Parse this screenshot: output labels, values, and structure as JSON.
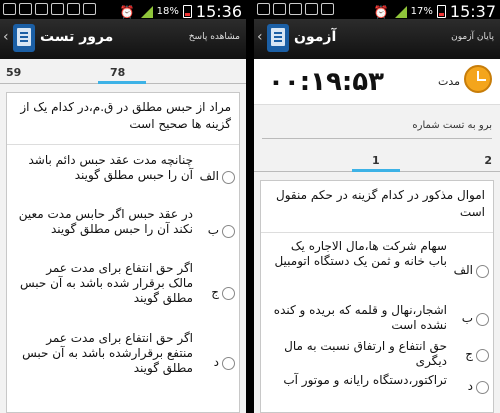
{
  "left": {
    "status": {
      "battery": "18%",
      "time": "15:36"
    },
    "header": {
      "title": "مرور تست",
      "action": "مشاهده پاسخ"
    },
    "tabs": [
      {
        "label": "59"
      },
      {
        "label": "78"
      }
    ],
    "question": "مراد از حبس مطلق در ق.م،در کدام یک از گزینه ها صحیح است",
    "options": [
      {
        "label": "الف",
        "text": "چنانچه مدت عقد حبس دائم باشد آن را حبس مطلق گویند"
      },
      {
        "label": "ب",
        "text": "در عقد حبس اگر حابس مدت معین نکند آن را حبس مطلق گویند"
      },
      {
        "label": "ج",
        "text": "اگر حق انتفاع برای مدت عمر مالک برقرار شده باشد به آن حبس مطلق گویند"
      },
      {
        "label": "د",
        "text": "اگر حق انتفاع برای مدت عمر منتفع برقرارشده باشد به آن حبس مطلق گویند"
      }
    ]
  },
  "right": {
    "status": {
      "battery": "17%",
      "time": "15:37"
    },
    "header": {
      "title": "آزمون",
      "action": "پایان آزمون"
    },
    "timer": {
      "value": "۰۰:۱۹:۵۳",
      "label": "مدت"
    },
    "goto": {
      "placeholder": "برو به تست شماره"
    },
    "tabs": [
      {
        "label": "2"
      },
      {
        "label": "1"
      }
    ],
    "question": "اموال مذکور در کدام گزینه در حکم منقول است",
    "options": [
      {
        "label": "الف",
        "text": "سهام شرکت ها،مال الاجاره یک باب خانه و ثمن یک دستگاه اتومبیل"
      },
      {
        "label": "ب",
        "text": "اشجار،نهال و قلمه که بریده و کنده نشده است"
      },
      {
        "label": "ج",
        "text": "حق انتفاع و ارتفاق نسبت به مال دیگری"
      },
      {
        "label": "د",
        "text": "تراکتور،دستگاه رایانه و موتور آب"
      }
    ]
  },
  "colors": {
    "accent": "#3db2e6",
    "actionbar": "#1f1f1f",
    "timer_icon": "#f4a51c"
  }
}
